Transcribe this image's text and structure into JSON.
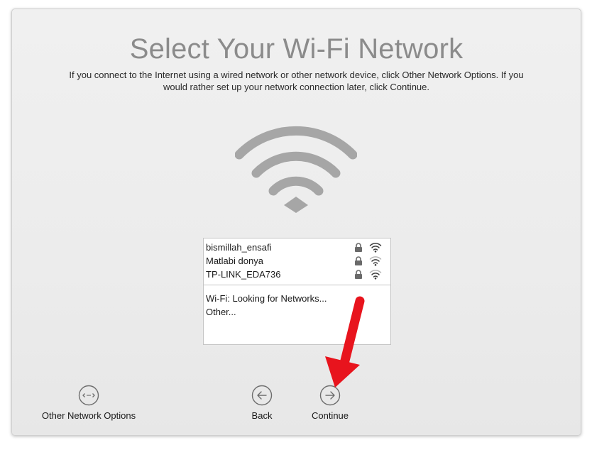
{
  "page": {
    "title": "Select Your Wi-Fi Network",
    "description": "If you connect to the Internet using a wired network or other network device, click Other Network Options. If you would rather set up your network connection later, click Continue."
  },
  "networks": [
    {
      "name": "bismillah_ensafi",
      "secured": true,
      "icon": "wifi-signal-icon"
    },
    {
      "name": "Matlabi donya",
      "secured": true,
      "icon": "wifi-signal-icon"
    },
    {
      "name": "TP-LINK_EDA736",
      "secured": true,
      "icon": "wifi-signal-icon"
    }
  ],
  "status": {
    "looking": "Wi-Fi: Looking for Networks...",
    "other": "Other..."
  },
  "buttons": {
    "other_options": "Other Network Options",
    "back": "Back",
    "continue": "Continue"
  },
  "colors": {
    "title": "#8b8b8b",
    "wifi_icon": "#a6a6a6",
    "annotation_arrow": "#e8141d"
  }
}
